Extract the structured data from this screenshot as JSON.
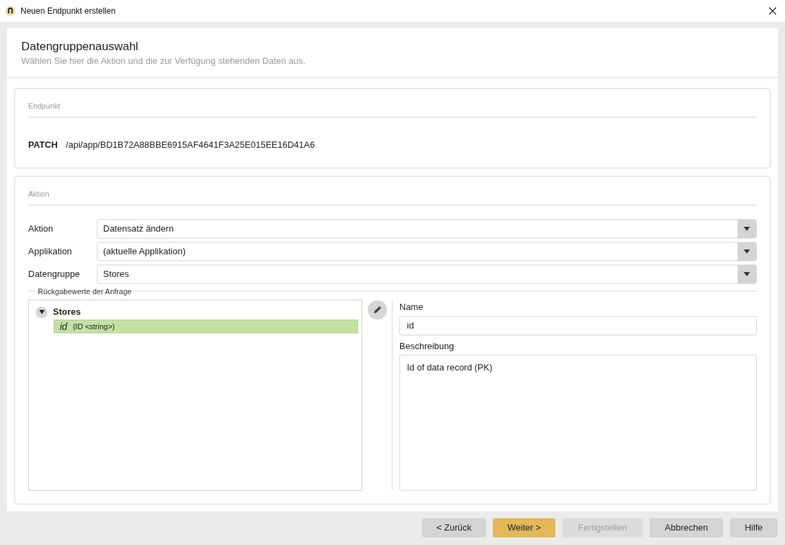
{
  "window": {
    "title": "Neuen Endpunkt erstellen"
  },
  "header": {
    "title": "Datengruppenauswahl",
    "subtitle": "Wählen Sie hier die Aktion und die zur Verfügung stehenden Daten aus."
  },
  "endpoint": {
    "legend": "Endpunkt",
    "method": "PATCH",
    "path": "/api/app/BD1B72A88BBE6915AF4641F3A25E015EE16D41A6"
  },
  "action": {
    "legend": "Aktion",
    "fields": [
      {
        "label": "Aktion",
        "value": "Datensatz ändern"
      },
      {
        "label": "Applikation",
        "value": "(aktuelle Applikation)"
      },
      {
        "label": "Datengruppe",
        "value": "Stores"
      }
    ],
    "return_values": {
      "legend": "Rückgabewerte der Anfrage",
      "tree": [
        {
          "label": "Stores",
          "expanded": true,
          "selected": false,
          "children": [
            {
              "label": "id",
              "type": "(ID <string>)",
              "selected": true
            }
          ]
        }
      ],
      "name_label": "Name",
      "name_value": "id",
      "description_label": "Beschreibung",
      "description_value": "Id of data record (PK)"
    }
  },
  "buttons": [
    {
      "label": "< Zurück",
      "kind": "default"
    },
    {
      "label": "Weiter >",
      "kind": "primary"
    },
    {
      "label": "Fertigstellen",
      "kind": "disabled"
    },
    {
      "label": "Abbrechen",
      "kind": "default"
    },
    {
      "label": "Hilfe",
      "kind": "default"
    }
  ]
}
